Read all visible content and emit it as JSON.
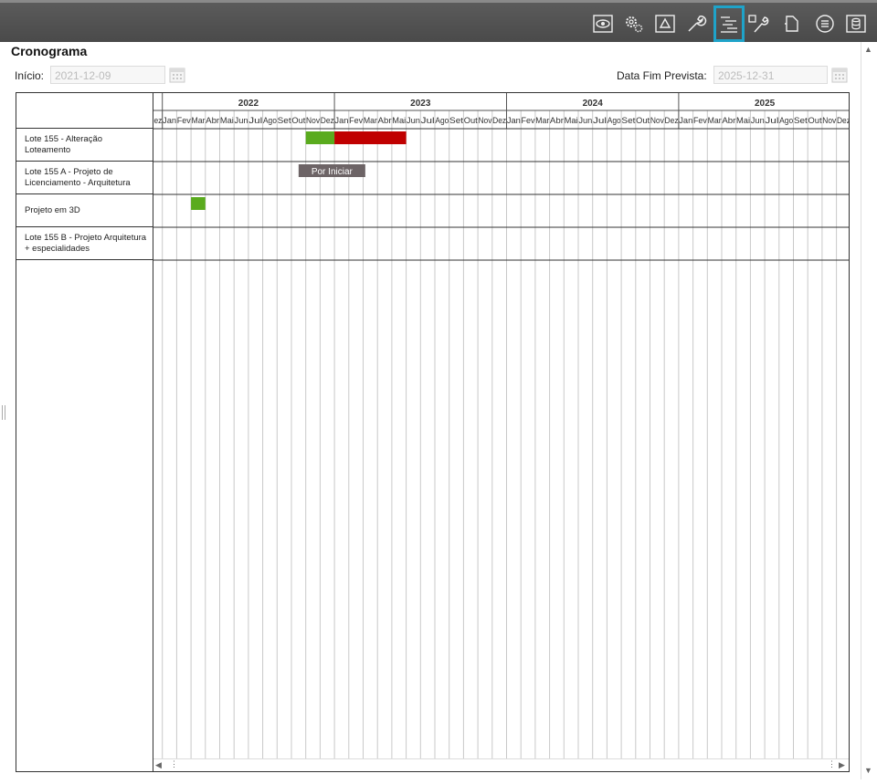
{
  "toolbar": {
    "icons": [
      "eye-icon",
      "gear-icon",
      "warning-icon",
      "wrench-icon",
      "gantt-icon",
      "tools-icon",
      "document-icon",
      "list-circle-icon",
      "database-icon"
    ],
    "active_icon": "gantt-icon"
  },
  "header": {
    "title": "Cronograma",
    "start_label": "Início:",
    "start_value": "2021-12-09",
    "end_label": "Data Fim Prevista:",
    "end_value": "2025-12-31"
  },
  "gantt": {
    "years": [
      "2022",
      "2023",
      "2024",
      "2025"
    ],
    "months": [
      "Dez",
      "Jan",
      "Fev",
      "Mar",
      "Abr",
      "Mai",
      "Jun",
      "Jul",
      "Ago",
      "Set",
      "Out",
      "Nov",
      "Dez",
      "Jan",
      "Fev",
      "Mar",
      "Abr",
      "Mai",
      "Jun",
      "Jul",
      "Ago",
      "Set",
      "Out",
      "Nov",
      "Dez",
      "Jan",
      "Fev",
      "Mar",
      "Abr",
      "Mai",
      "Jun",
      "Jul",
      "Ago",
      "Set",
      "Out",
      "Nov",
      "Dez",
      "Jan",
      "Fev",
      "Mar",
      "Abr",
      "Mai",
      "Jun",
      "Jul",
      "Ago",
      "Set",
      "Out",
      "Nov",
      "Dez"
    ],
    "tasks": [
      {
        "name": "Lote 155 - Alteração Loteamento"
      },
      {
        "name": "Lote 155 A - Projeto de Licenciamento - Arquitetura"
      },
      {
        "name": "Projeto em 3D"
      },
      {
        "name": "Lote 155 B - Projeto Arquitetura + especialidades"
      }
    ],
    "bars": [
      {
        "task": 0,
        "start": "2022-11",
        "end": "2022-12",
        "color": "#5aab1e"
      },
      {
        "task": 0,
        "start": "2023-01",
        "end": "2023-05",
        "color": "#c00000"
      },
      {
        "task": 2,
        "start": "2022-03",
        "end": "2022-03",
        "color": "#5aab1e"
      }
    ],
    "status_badge": {
      "task": 1,
      "label": "Por Iniciar"
    }
  },
  "colors": {
    "toolbar_bg": "#4f4f4f",
    "active_border": "#1fa3c9",
    "done": "#5aab1e",
    "late": "#c00000",
    "badge_bg": "#6d6466"
  }
}
